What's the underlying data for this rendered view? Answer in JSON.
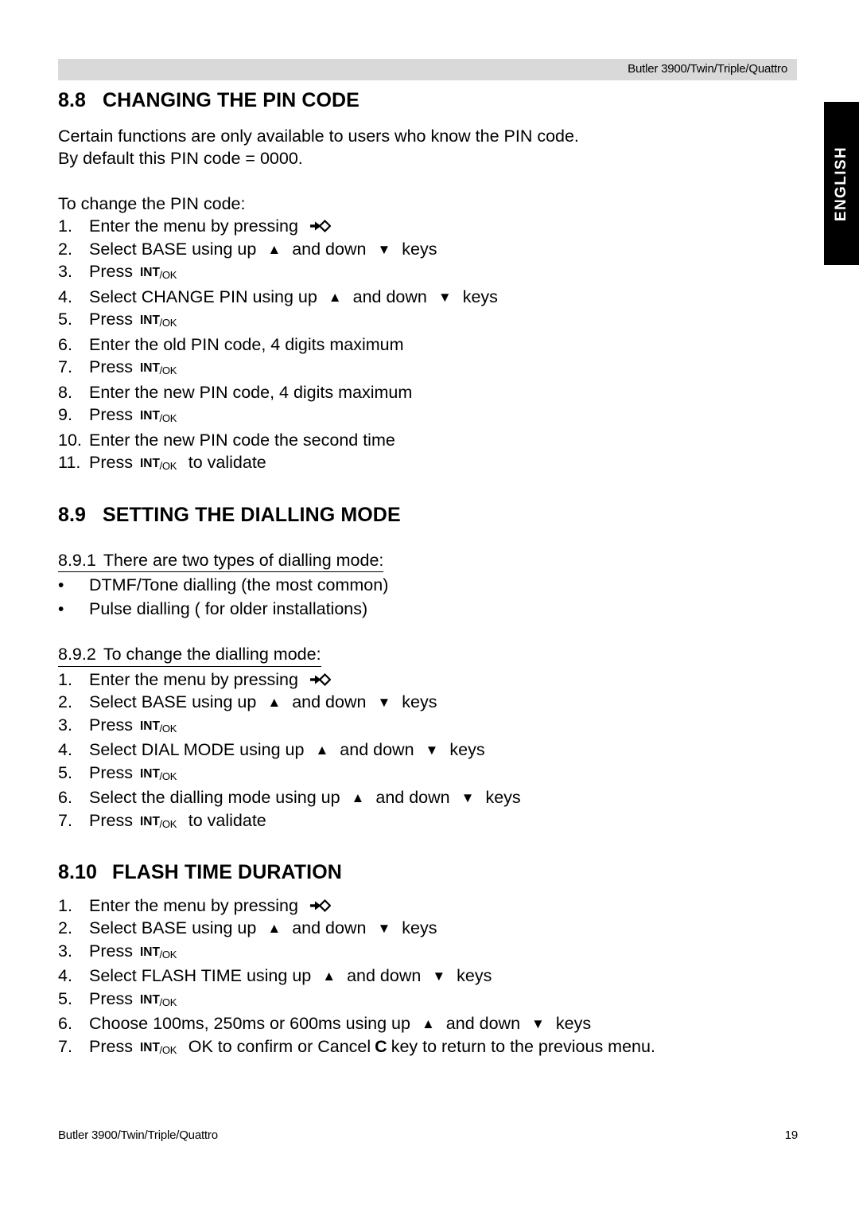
{
  "header": {
    "product_line": "Butler 3900/Twin/Triple/Quattro"
  },
  "side_tab": {
    "label": "ENGLISH"
  },
  "footer": {
    "left": "Butler 3900/Twin/Triple/Quattro",
    "page_number": "19"
  },
  "icons": {
    "menu_key": "menu-key-icon",
    "up_key": "▲",
    "down_key": "▼",
    "int_main": "INT",
    "int_sub": "/OK"
  },
  "sections": [
    {
      "number": "8.8",
      "title": "CHANGING THE PIN CODE",
      "paragraphs": [
        "Certain functions are only available to users who know the PIN code.",
        "By default this PIN code = 0000."
      ],
      "lead_in": "To change the PIN code:",
      "steps": [
        {
          "marker": "1.",
          "before": "Enter the menu by pressing",
          "icon": "menu"
        },
        {
          "marker": "2.",
          "before": "Select BASE using up",
          "icon": "updown",
          "mid": "and down",
          "after": "keys"
        },
        {
          "marker": "3.",
          "before": "Press",
          "icon": "intok"
        },
        {
          "marker": "4.",
          "before": "Select CHANGE PIN using up",
          "icon": "updown",
          "mid": "and down",
          "after": "keys"
        },
        {
          "marker": "5.",
          "before": "Press",
          "icon": "intok"
        },
        {
          "marker": "6.",
          "before": "Enter the old PIN code, 4 digits maximum",
          "icon": "none"
        },
        {
          "marker": "7.",
          "before": "Press",
          "icon": "intok"
        },
        {
          "marker": "8.",
          "before": "Enter the new PIN code, 4 digits maximum",
          "icon": "none"
        },
        {
          "marker": "9.",
          "before": "Press",
          "icon": "intok"
        },
        {
          "marker": "10.",
          "before": "Enter the new PIN code the second time",
          "icon": "none"
        },
        {
          "marker": "11.",
          "before": "Press",
          "icon": "intok",
          "after": "to validate"
        }
      ]
    },
    {
      "number": "8.9",
      "title": "SETTING THE DIALLING MODE",
      "subsections": [
        {
          "number": "8.9.1",
          "title": "There are two types of dialling mode:",
          "bullets": [
            "DTMF/Tone dialling (the most common)",
            "Pulse dialling ( for older installations)"
          ]
        },
        {
          "number": "8.9.2",
          "title": "To change the dialling mode:",
          "steps": [
            {
              "marker": "1.",
              "before": "Enter the menu by pressing",
              "icon": "menu"
            },
            {
              "marker": "2.",
              "before": "Select BASE using up",
              "icon": "updown",
              "mid": "and down",
              "after": "keys"
            },
            {
              "marker": "3.",
              "before": "Press",
              "icon": "intok"
            },
            {
              "marker": "4.",
              "before": "Select DIAL MODE using up",
              "icon": "updown",
              "mid": "and down",
              "after": "keys"
            },
            {
              "marker": "5.",
              "before": "Press",
              "icon": "intok"
            },
            {
              "marker": "6.",
              "before": "Select the dialling mode using up",
              "icon": "updown",
              "mid": "and down",
              "after": "keys"
            },
            {
              "marker": "7.",
              "before": "Press",
              "icon": "intok",
              "after": "to validate"
            }
          ]
        }
      ]
    },
    {
      "number": "8.10",
      "title": "FLASH TIME DURATION",
      "steps": [
        {
          "marker": "1.",
          "before": "Enter the menu by pressing",
          "icon": "menu"
        },
        {
          "marker": "2.",
          "before": "Select BASE using up",
          "icon": "updown",
          "mid": "and down",
          "after": "keys"
        },
        {
          "marker": "3.",
          "before": "Press",
          "icon": "intok"
        },
        {
          "marker": "4.",
          "before": "Select FLASH TIME using up",
          "icon": "updown",
          "mid": "and down",
          "after": "keys"
        },
        {
          "marker": "5.",
          "before": "Press",
          "icon": "intok"
        },
        {
          "marker": "6.",
          "before": "Choose 100ms, 250ms or 600ms using up",
          "icon": "updown",
          "mid": "and down",
          "after": "keys"
        },
        {
          "marker": "7.",
          "before": "Press",
          "icon": "intok",
          "after_pre": "OK to confirm or Cancel",
          "after_bold": "C",
          "after_post": "key  to return to the previous menu."
        }
      ]
    }
  ]
}
